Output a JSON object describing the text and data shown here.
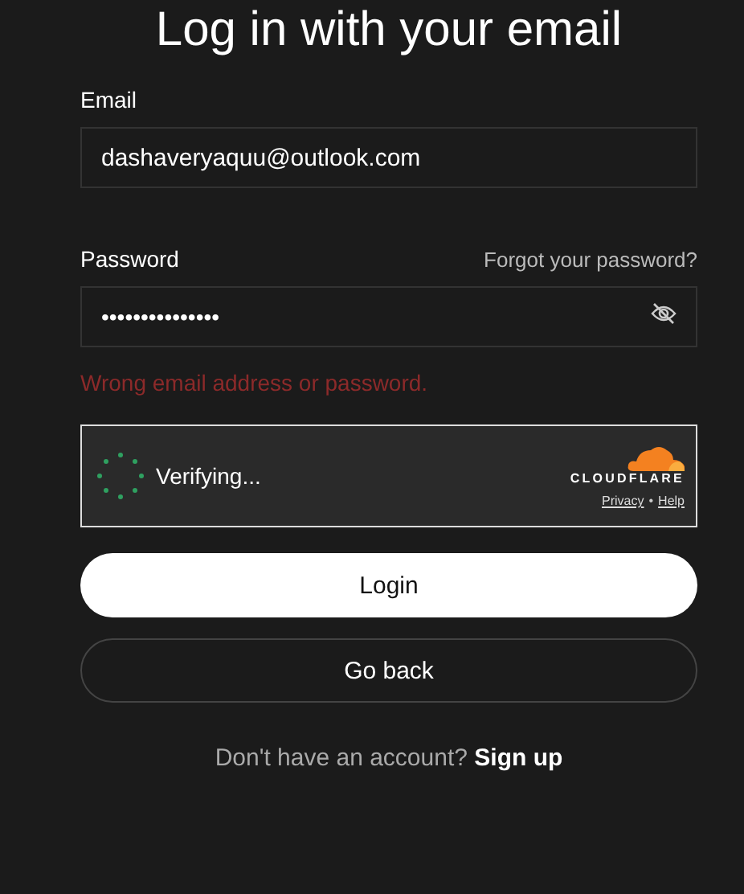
{
  "title": "Log in with your email",
  "email": {
    "label": "Email",
    "value": "dashaveryaquu@outlook.com"
  },
  "password": {
    "label": "Password",
    "forgot_link": "Forgot your password?",
    "value_mask": "•••••••••••••••",
    "revealed": false
  },
  "error": "Wrong email address or password.",
  "captcha": {
    "status": "Verifying...",
    "brand": "CLOUDFLARE",
    "links": [
      "Privacy",
      "Help"
    ],
    "separator": "•"
  },
  "buttons": [
    {
      "label": "Login",
      "kind": "primary"
    },
    {
      "label": "Go back",
      "kind": "secondary"
    }
  ],
  "footer": {
    "text": "Don't have an account?",
    "link": "Sign up"
  }
}
